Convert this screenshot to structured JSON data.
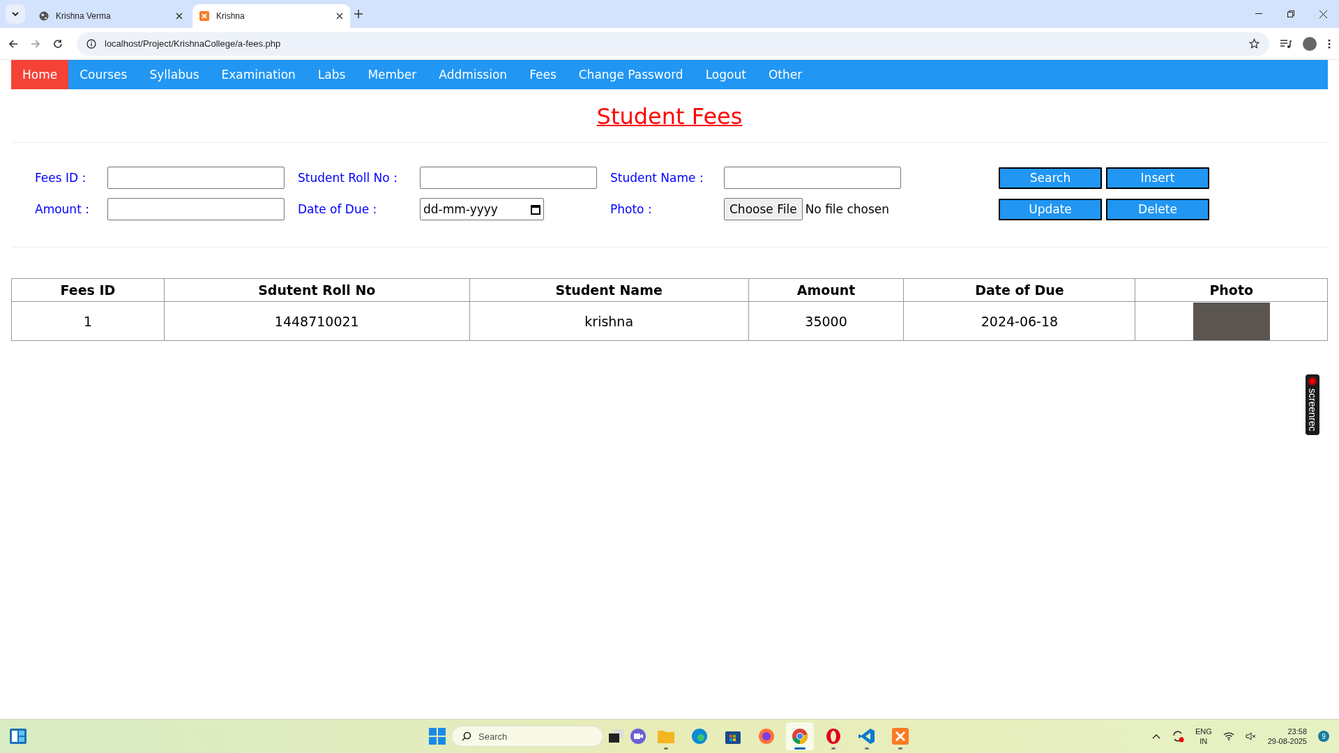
{
  "browser": {
    "tabs": [
      {
        "title": "Krishna Verma",
        "selected": false
      },
      {
        "title": "Krishna",
        "selected": true
      }
    ],
    "url": "localhost/Project/KrishnaCollege/a-fees.php"
  },
  "nav": [
    {
      "label": "Home",
      "selected": true
    },
    {
      "label": "Courses",
      "selected": false
    },
    {
      "label": "Syllabus",
      "selected": false
    },
    {
      "label": "Examination",
      "selected": false
    },
    {
      "label": "Labs",
      "selected": false
    },
    {
      "label": "Member",
      "selected": false
    },
    {
      "label": "Addmission",
      "selected": false
    },
    {
      "label": "Fees",
      "selected": false
    },
    {
      "label": "Change Password",
      "selected": false
    },
    {
      "label": "Logout",
      "selected": false
    },
    {
      "label": "Other",
      "selected": false
    }
  ],
  "page_title": "Student Fees",
  "form": {
    "fields": [
      {
        "kind": "text",
        "label": "Fees ID :"
      },
      {
        "kind": "text",
        "label": "Student Roll No :"
      },
      {
        "kind": "text",
        "label": "Student Name :"
      },
      {
        "kind": "text",
        "label": "Amount :"
      },
      {
        "kind": "date",
        "label": "Date of Due :",
        "value": "dd-mm-yyyy"
      },
      {
        "kind": "file",
        "label": "Photo :",
        "button": "Choose File",
        "status": "No file chosen"
      }
    ],
    "buttons": [
      "Search",
      "Insert",
      "Update",
      "Delete"
    ]
  },
  "table": {
    "columns": [
      "Fees ID",
      "Sdutent Roll No",
      "Student Name",
      "Amount",
      "Date of Due",
      "Photo"
    ],
    "rows": [
      {
        "cells": [
          "1",
          "1448710021",
          "krishna",
          "35000",
          "2024-06-18"
        ],
        "photo": true
      }
    ]
  },
  "recorder": {
    "label": "screenrec"
  },
  "taskbar": {
    "search": "Search",
    "apps": [
      {
        "kind": "explorer",
        "running": true,
        "selected": false
      },
      {
        "kind": "edge",
        "running": false,
        "selected": false
      },
      {
        "kind": "store",
        "running": false,
        "selected": false
      },
      {
        "kind": "firefox",
        "running": false,
        "selected": false
      },
      {
        "kind": "chrome",
        "running": true,
        "selected": true
      },
      {
        "kind": "opera",
        "running": true,
        "selected": false
      },
      {
        "kind": "vscode",
        "running": true,
        "selected": false
      },
      {
        "kind": "xampp",
        "running": true,
        "selected": false
      }
    ],
    "lang": "ENG",
    "region": "IN",
    "time": "23:58",
    "date": "29-08-2025",
    "notifications": "9"
  }
}
